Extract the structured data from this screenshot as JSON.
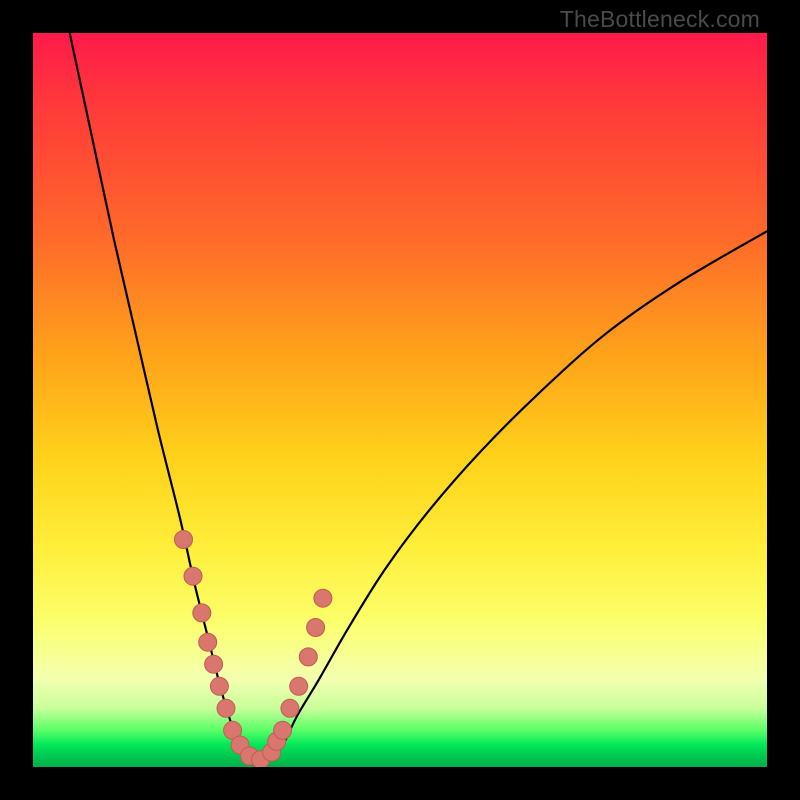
{
  "watermark": "TheBottleneck.com",
  "colors": {
    "frame": "#000000",
    "curve": "#000000",
    "dot_fill": "#d9776f",
    "dot_stroke": "#c25a54"
  },
  "chart_data": {
    "type": "line",
    "title": "",
    "xlabel": "",
    "ylabel": "",
    "xlim": [
      0,
      100
    ],
    "ylim": [
      0,
      100
    ],
    "series": [
      {
        "name": "bottleneck-curve",
        "x": [
          5,
          8,
          11,
          14,
          17,
          20,
          22,
          24,
          25.5,
          27,
          28.5,
          30,
          32,
          34,
          36,
          39,
          43,
          48,
          54,
          61,
          69,
          78,
          88,
          100
        ],
        "y": [
          100,
          86,
          72,
          59,
          46,
          34,
          25,
          17,
          11,
          6,
          3,
          1,
          1,
          3,
          7,
          12,
          19,
          27,
          35,
          43,
          51,
          59,
          66,
          73
        ]
      }
    ],
    "dots": {
      "name": "highlight-points",
      "x": [
        20.5,
        21.8,
        23.0,
        23.8,
        24.6,
        25.4,
        26.3,
        27.2,
        28.2,
        29.5,
        31.0,
        32.5,
        33.2,
        34.0,
        35.0,
        36.2,
        37.5,
        38.5,
        39.5
      ],
      "y": [
        31,
        26,
        21,
        17,
        14,
        11,
        8,
        5,
        3,
        1.5,
        1,
        2,
        3.5,
        5,
        8,
        11,
        15,
        19,
        23
      ]
    }
  }
}
